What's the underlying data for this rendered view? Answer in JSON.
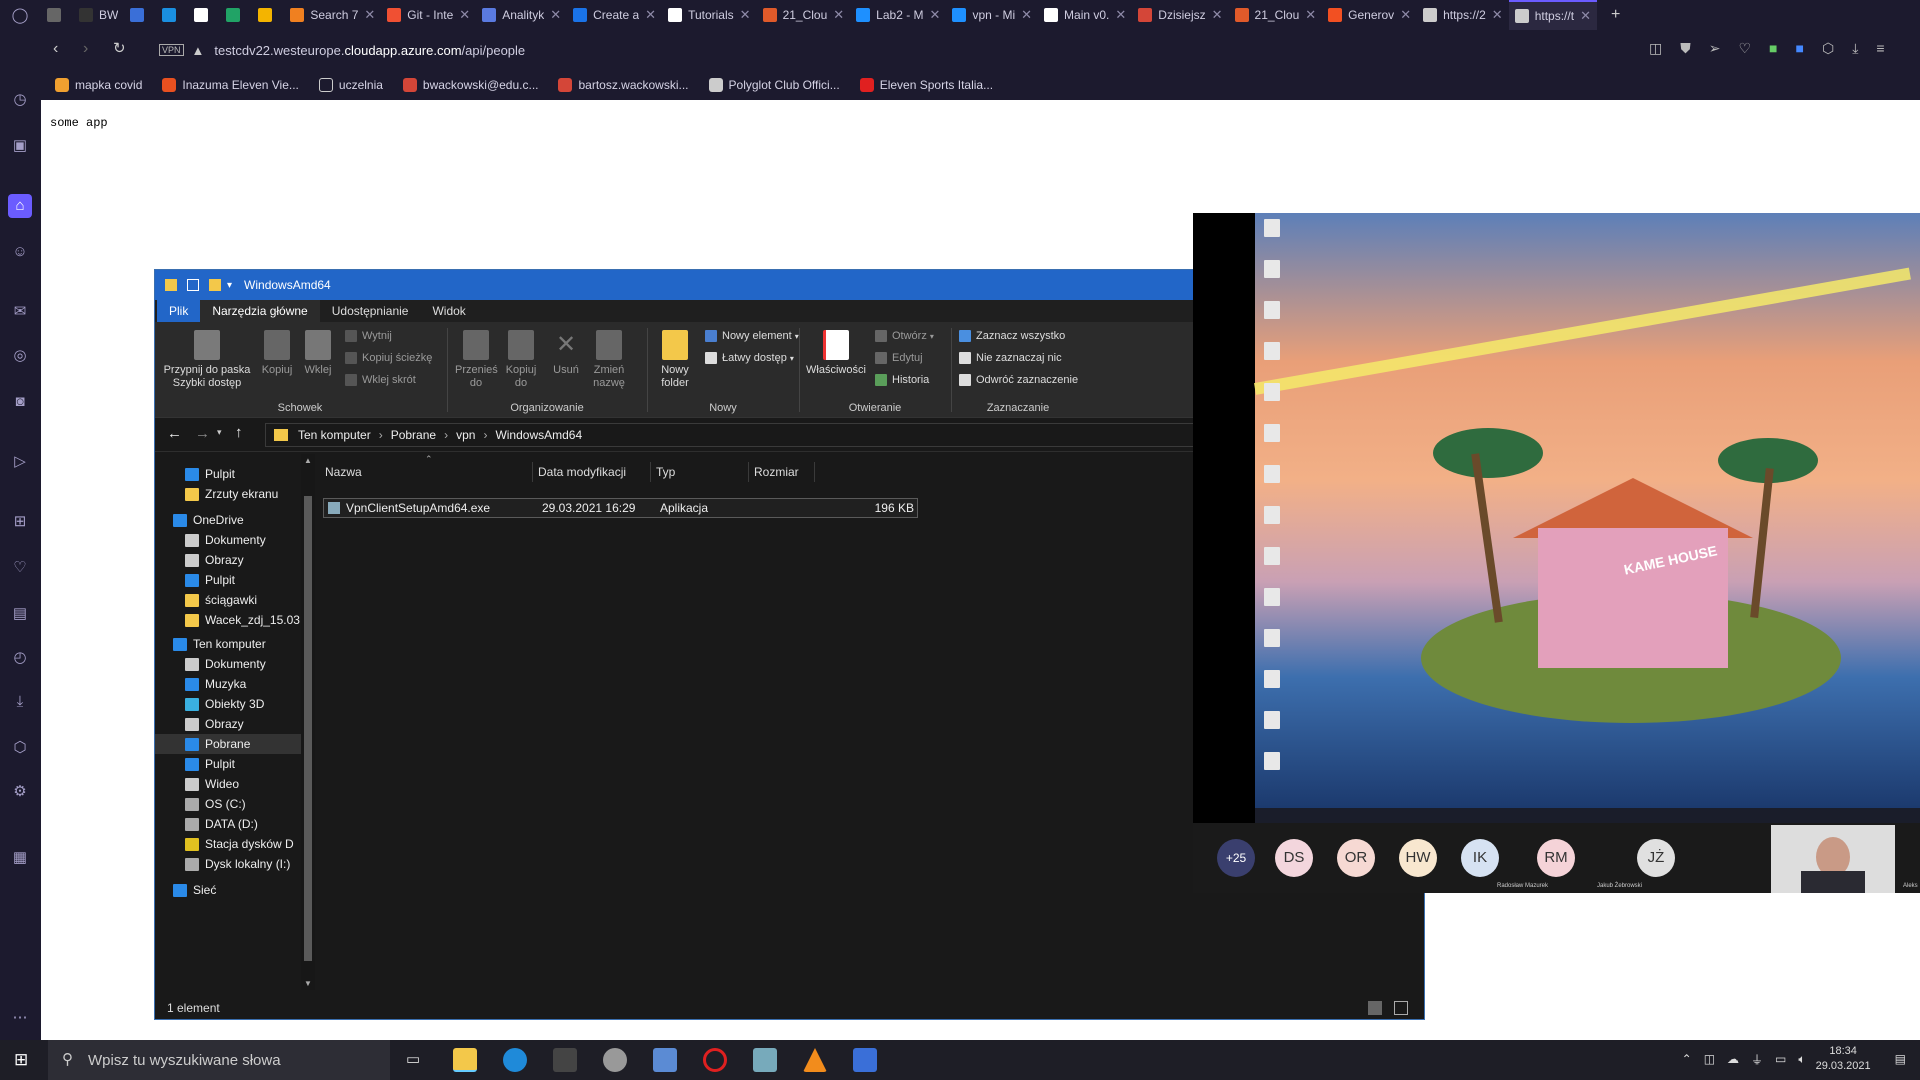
{
  "browser": {
    "tabs": [
      {
        "label": "",
        "icon": "tab-icon"
      },
      {
        "label": "BW",
        "icon": "bw-icon"
      },
      {
        "label": "",
        "icon": "puzzle-icon"
      },
      {
        "label": "",
        "icon": "j-icon"
      },
      {
        "label": "",
        "icon": "doc-icon"
      },
      {
        "label": "",
        "icon": "sheets-icon"
      },
      {
        "label": "",
        "icon": "drive-icon"
      },
      {
        "label": "Search 7",
        "icon": "search-icon"
      },
      {
        "label": "Git - Inte",
        "icon": "git-icon"
      },
      {
        "label": "Analityk",
        "icon": "puzzle-icon"
      },
      {
        "label": "Create a",
        "icon": "create-icon"
      },
      {
        "label": "Tutorials",
        "icon": "tutorials-icon"
      },
      {
        "label": "21_Clou",
        "icon": "in-icon"
      },
      {
        "label": "Lab2 - M",
        "icon": "azure-icon"
      },
      {
        "label": "vpn - Mi",
        "icon": "azure-icon"
      },
      {
        "label": "Main v0.",
        "icon": "square-icon"
      },
      {
        "label": "Dzisiejsz",
        "icon": "gmail-icon"
      },
      {
        "label": "21_Clou",
        "icon": "in-icon"
      },
      {
        "label": "Generov",
        "icon": "ms-icon"
      },
      {
        "label": "https://2",
        "icon": "page-icon"
      },
      {
        "label": "https://t",
        "icon": "page-icon"
      }
    ],
    "url_prefix": "testcdv22.westeurope.",
    "url_domain": "cloudapp.azure.com",
    "url_path": "/api/people",
    "vpn_label": "VPN",
    "bookmarks": [
      "mapka covid",
      "Inazuma Eleven Vie...",
      "uczelnia",
      "bwackowski@edu.c...",
      "bartosz.wackowski...",
      "Polyglot Club Offici...",
      "Eleven Sports Italia..."
    ],
    "page_text": "some app"
  },
  "explorer": {
    "title": "WindowsAmd64",
    "menu": {
      "file": "Plik",
      "home": "Narzędzia główne",
      "share": "Udostępnianie",
      "view": "Widok"
    },
    "ribbon": {
      "clipboard": {
        "label": "Schowek",
        "pin": "Przypnij do paska Szybki dostęp",
        "copy": "Kopiuj",
        "paste": "Wklej",
        "cut": "Wytnij",
        "copy_path": "Kopiuj ścieżkę",
        "paste_shortcut": "Wklej skrót"
      },
      "organize": {
        "label": "Organizowanie",
        "move": "Przenieś do",
        "copy_to": "Kopiuj do",
        "delete": "Usuń",
        "rename": "Zmień nazwę"
      },
      "new": {
        "label": "Nowy",
        "folder": "Nowy folder",
        "new_item": "Nowy element",
        "easy_access": "Łatwy dostęp"
      },
      "open": {
        "label": "Otwieranie",
        "properties": "Właściwości",
        "open": "Otwórz",
        "edit": "Edytuj",
        "history": "Historia"
      },
      "select": {
        "label": "Zaznaczanie",
        "all": "Zaznacz wszystko",
        "none": "Nie zaznaczaj nic",
        "invert": "Odwróć zaznaczenie"
      }
    },
    "breadcrumb": [
      "Ten komputer",
      "Pobrane",
      "vpn",
      "WindowsAmd64"
    ],
    "nav": [
      "Pulpit",
      "Zrzuty ekranu",
      "OneDrive",
      "Dokumenty",
      "Obrazy",
      "Pulpit",
      "ściągawki",
      "Wacek_zdj_15.03",
      "Ten komputer",
      "Dokumenty",
      "Muzyka",
      "Obiekty 3D",
      "Obrazy",
      "Pobrane",
      "Pulpit",
      "Wideo",
      "OS (C:)",
      "DATA (D:)",
      "Stacja dysków D",
      "Dysk lokalny (I:)",
      "Sieć"
    ],
    "columns": {
      "name": "Nazwa",
      "date": "Data modyfikacji",
      "type": "Typ",
      "size": "Rozmiar"
    },
    "file": {
      "name": "VpnClientSetupAmd64.exe",
      "date": "29.03.2021 16:29",
      "type": "Aplikacja",
      "size": "196 KB"
    },
    "status": "1 element"
  },
  "zoom": {
    "house_text": "KAME HOUSE",
    "more_count": "+25",
    "participants": [
      {
        "initials": "DS",
        "color": "#f3d6dd"
      },
      {
        "initials": "OR",
        "color": "#f6d9d3"
      },
      {
        "initials": "HW",
        "color": "#f8e7cf"
      },
      {
        "initials": "IK",
        "color": "#d6e2f2"
      },
      {
        "initials": "RM",
        "color": "#f5d3d8",
        "name": "Radosław Mazurek"
      },
      {
        "initials": "JŻ",
        "color": "#e0e0e0",
        "name": "Jakub Żebrowski"
      }
    ],
    "edge_name": "Aleks"
  },
  "taskbar": {
    "search_placeholder": "Wpisz tu wyszukiwane słowa",
    "time": "18:34",
    "date": "29.03.2021"
  }
}
